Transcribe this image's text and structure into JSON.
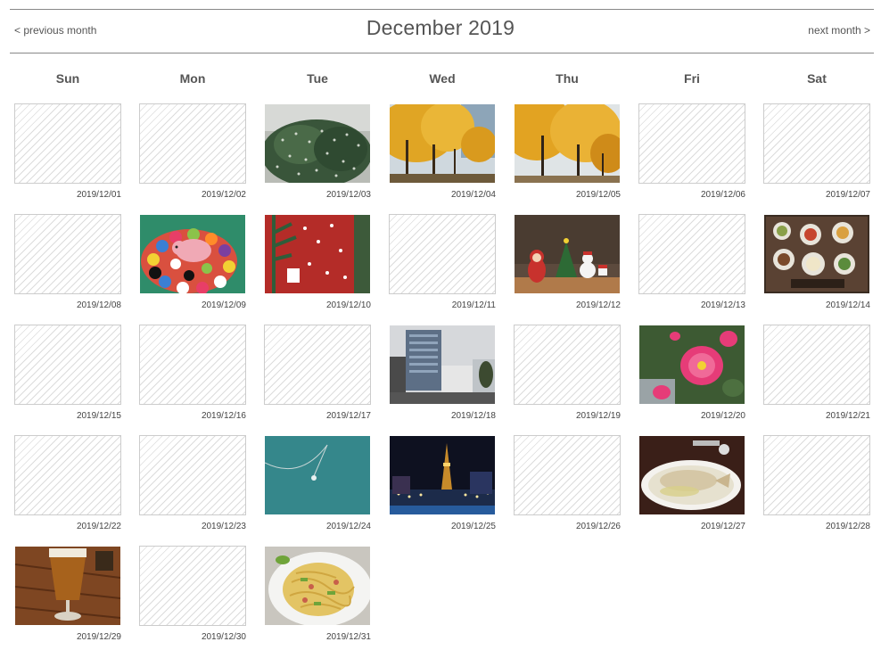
{
  "header": {
    "title": "December 2019",
    "prev_label": "< previous month",
    "next_label": "next month >"
  },
  "weekdays": [
    "Sun",
    "Mon",
    "Tue",
    "Wed",
    "Thu",
    "Fri",
    "Sat"
  ],
  "days": [
    {
      "date": "2019/12/01",
      "photo": null
    },
    {
      "date": "2019/12/02",
      "photo": null
    },
    {
      "date": "2019/12/03",
      "photo": "bush-photo"
    },
    {
      "date": "2019/12/04",
      "photo": "ginkgo-avenue-photo"
    },
    {
      "date": "2019/12/05",
      "photo": "ginkgo-trees-photo"
    },
    {
      "date": "2019/12/06",
      "photo": null
    },
    {
      "date": "2019/12/07",
      "photo": null
    },
    {
      "date": "2019/12/08",
      "photo": null
    },
    {
      "date": "2019/12/09",
      "photo": "felt-ball-pig-photo"
    },
    {
      "date": "2019/12/10",
      "photo": "christmas-cup-photo"
    },
    {
      "date": "2019/12/11",
      "photo": null
    },
    {
      "date": "2019/12/12",
      "photo": "christmas-figurines-photo"
    },
    {
      "date": "2019/12/13",
      "photo": null
    },
    {
      "date": "2019/12/14",
      "photo": "lunch-tray-photo"
    },
    {
      "date": "2019/12/15",
      "photo": null
    },
    {
      "date": "2019/12/16",
      "photo": null
    },
    {
      "date": "2019/12/17",
      "photo": null
    },
    {
      "date": "2019/12/18",
      "photo": "city-building-photo"
    },
    {
      "date": "2019/12/19",
      "photo": null
    },
    {
      "date": "2019/12/20",
      "photo": "pink-camellia-photo"
    },
    {
      "date": "2019/12/21",
      "photo": null
    },
    {
      "date": "2019/12/22",
      "photo": null
    },
    {
      "date": "2019/12/23",
      "photo": null
    },
    {
      "date": "2019/12/24",
      "photo": "necklace-photo"
    },
    {
      "date": "2019/12/25",
      "photo": "night-tower-photo"
    },
    {
      "date": "2019/12/26",
      "photo": null
    },
    {
      "date": "2019/12/27",
      "photo": "fish-dish-photo"
    },
    {
      "date": "2019/12/28",
      "photo": null
    },
    {
      "date": "2019/12/29",
      "photo": "beer-glass-photo"
    },
    {
      "date": "2019/12/30",
      "photo": null
    },
    {
      "date": "2019/12/31",
      "photo": "pasta-photo"
    }
  ]
}
